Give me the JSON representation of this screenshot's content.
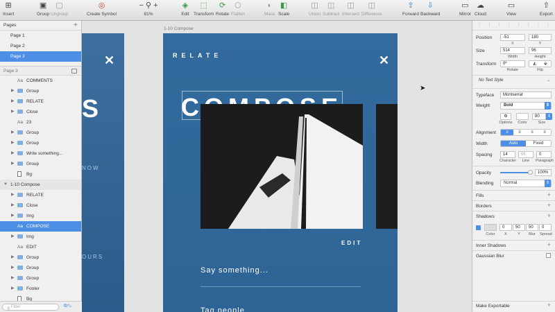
{
  "toolbar": {
    "items": [
      {
        "label": "Insert",
        "icon": "insert-icon"
      },
      {
        "label": "Group",
        "icon": "group-icon"
      },
      {
        "label": "Ungroup",
        "icon": "ungroup-icon"
      },
      {
        "label": "Create Symbol",
        "icon": "symbol-icon"
      },
      {
        "label": "81%",
        "icon": "zoom-icon"
      },
      {
        "label": "Edit",
        "icon": "edit-icon"
      },
      {
        "label": "Transform",
        "icon": "transform-icon"
      },
      {
        "label": "Rotate",
        "icon": "rotate-icon"
      },
      {
        "label": "Flatten",
        "icon": "flatten-icon"
      },
      {
        "label": "Mask",
        "icon": "mask-icon"
      },
      {
        "label": "Scale",
        "icon": "scale-icon"
      },
      {
        "label": "Union",
        "icon": "union-icon"
      },
      {
        "label": "Subtract",
        "icon": "subtract-icon"
      },
      {
        "label": "Intersect",
        "icon": "intersect-icon"
      },
      {
        "label": "Difference",
        "icon": "difference-icon"
      },
      {
        "label": "Forward",
        "icon": "forward-icon"
      },
      {
        "label": "Backward",
        "icon": "backward-icon"
      },
      {
        "label": "Mirror",
        "icon": "mirror-icon"
      },
      {
        "label": "Cloud",
        "icon": "cloud-icon"
      },
      {
        "label": "View",
        "icon": "view-icon"
      },
      {
        "label": "Export",
        "icon": "export-icon"
      }
    ]
  },
  "pages": {
    "header": "Pages",
    "items": [
      "Page 1",
      "Page 2",
      "Page 3"
    ],
    "selected": "Page 3"
  },
  "layers": {
    "header": "Page 3",
    "items": [
      {
        "label": "COMMENTS",
        "type": "text"
      },
      {
        "label": "Group",
        "type": "folder"
      },
      {
        "label": "RELATE",
        "type": "folder"
      },
      {
        "label": "Close",
        "type": "folder"
      },
      {
        "label": "23",
        "type": "text"
      },
      {
        "label": "Group",
        "type": "folder"
      },
      {
        "label": "Group",
        "type": "folder"
      },
      {
        "label": "Write something...",
        "type": "folder"
      },
      {
        "label": "Group",
        "type": "folder"
      },
      {
        "label": "Bg",
        "type": "rect"
      },
      {
        "label": "1-10 Compose",
        "type": "artboard"
      },
      {
        "label": "RELATE",
        "type": "folder"
      },
      {
        "label": "Close",
        "type": "folder"
      },
      {
        "label": "Img",
        "type": "folder"
      },
      {
        "label": "COMPOSE",
        "type": "text",
        "selected": true
      },
      {
        "label": "Img",
        "type": "folder"
      },
      {
        "label": "EDIT",
        "type": "text"
      },
      {
        "label": "Group",
        "type": "folder"
      },
      {
        "label": "Group",
        "type": "folder"
      },
      {
        "label": "Group",
        "type": "folder"
      },
      {
        "label": "Footer",
        "type": "folder"
      },
      {
        "label": "Bg",
        "type": "rect"
      }
    ],
    "filter_placeholder": "Filter"
  },
  "canvas": {
    "artboard_label": "1-10 Compose",
    "relate": "RELATE",
    "compose": "COMPOSE",
    "edit": "EDIT",
    "say": "Say something...",
    "tag": "Tag people",
    "left_s": "S",
    "left_now": "NOW",
    "left_ours": "OURS",
    "close_glyph": "✕"
  },
  "inspector": {
    "position_label": "Position",
    "x": "-51",
    "y": "180",
    "x_label": "X",
    "y_label": "Y",
    "size_label": "Size",
    "width": "514",
    "height": "96",
    "width_label": "Width",
    "height_label": "Height",
    "transform_label": "Transform",
    "rotate": "0º",
    "rotate_label": "Rotate",
    "flip_label": "Flip",
    "text_style": "No Text Style",
    "typeface_label": "Typeface",
    "typeface": "Montserrat",
    "weight_label": "Weight",
    "weight": "Bold",
    "options_label": "Options",
    "color_label": "Color",
    "size_small_label": "Size",
    "font_size": "80",
    "alignment_label": "Alignment",
    "width2_label": "Width",
    "width_auto": "Auto",
    "width_fixed": "Fixed",
    "spacing_label": "Spacing",
    "character": "14",
    "line": "96",
    "paragraph": "0",
    "character_label": "Character",
    "line_label": "Line",
    "paragraph_label": "Paragraph",
    "opacity_label": "Opacity",
    "opacity": "100%",
    "blending_label": "Blending",
    "blending": "Normal",
    "fills": "Fills",
    "borders": "Borders",
    "shadows": "Shadows",
    "shadow_x": "0",
    "shadow_y": "50",
    "shadow_blur": "50",
    "shadow_spread": "0",
    "shadow_color_label": "Color",
    "shadow_x_label": "X",
    "shadow_y_label": "Y",
    "shadow_blur_label": "Blur",
    "shadow_spread_label": "Spread",
    "inner_shadows": "Inner Shadows",
    "gaussian_blur": "Gaussian Blur",
    "make_exportable": "Make Exportable"
  }
}
